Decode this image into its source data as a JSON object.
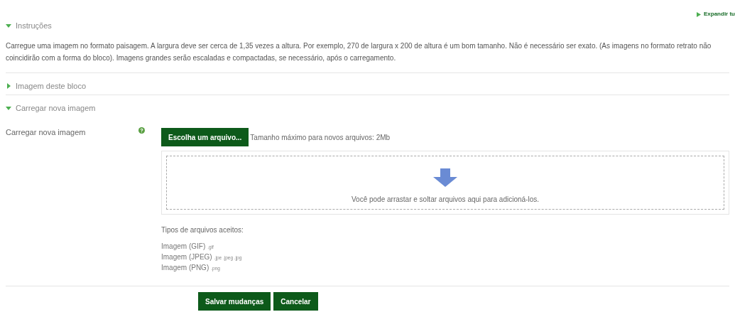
{
  "expand_all": "Expandir tu",
  "sections": [
    {
      "title": "Instruções",
      "expanded": true,
      "kind": "text",
      "text": "Carregue uma imagem no formato paisagem. A largura deve ser cerca de 1,35 vezes a altura. Por exemplo, 270 de largura x 200 de altura é um bom tamanho. Não é necessário ser exato. (As imagens no formato retrato não coincidirão com a forma do bloco). Imagens grandes serão escaladas e compactadas, se necessário, após o carregamento."
    },
    {
      "title": "Imagem deste bloco",
      "expanded": false
    },
    {
      "title": "Carregar nova imagem",
      "expanded": true,
      "kind": "upload",
      "field_label": "Carregar nova imagem",
      "choose_button": "Escolha um arquivo...",
      "max_size": "Tamanho máximo para novos arquivos: 2Mb",
      "drop_hint": "Você pode arrastar e soltar arquivos aqui para adicioná-los.",
      "types_title": "Tipos de arquivos aceitos:",
      "types": [
        {
          "name": "Imagem (GIF)",
          "ext": ".gif"
        },
        {
          "name": "Imagem (JPEG)",
          "ext": ".jpe .jpeg .jpg"
        },
        {
          "name": "Imagem (PNG)",
          "ext": ".png"
        }
      ]
    }
  ],
  "buttons": [
    "Salvar mudanças",
    "Cancelar"
  ]
}
